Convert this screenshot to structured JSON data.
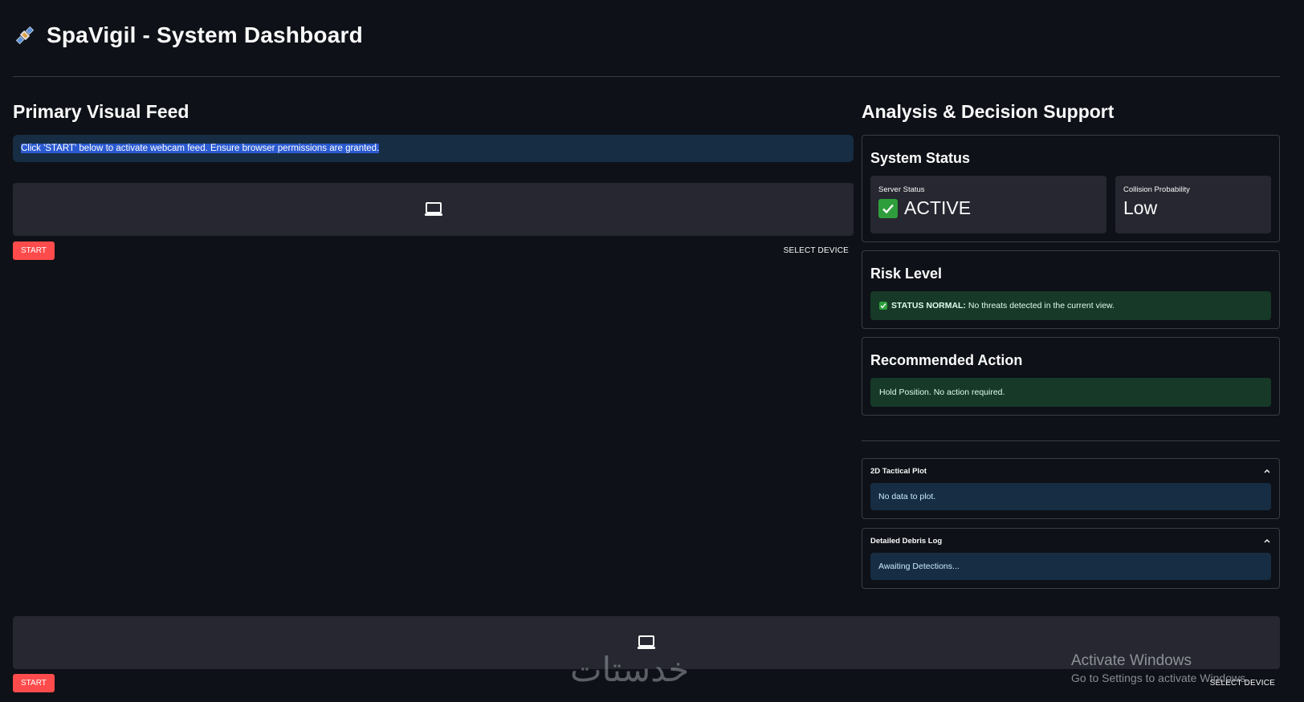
{
  "header": {
    "title": "SpaVigil - System Dashboard",
    "icon": "satellite-icon"
  },
  "left": {
    "heading": "Primary Visual Feed",
    "info": "Click 'START' below to activate webcam feed. Ensure browser permissions are granted.",
    "start_label": "START",
    "select_device_label": "SELECT DEVICE"
  },
  "right": {
    "heading": "Analysis & Decision Support",
    "system_status": {
      "heading": "System Status",
      "server_label": "Server Status",
      "server_value": "ACTIVE",
      "collision_label": "Collision Probability",
      "collision_value": "Low"
    },
    "risk": {
      "heading": "Risk Level",
      "status_bold": "STATUS NORMAL:",
      "status_text": " No threats detected in the current view."
    },
    "recommended": {
      "heading": "Recommended Action",
      "text": "Hold Position. No action required."
    },
    "expanders": [
      {
        "title": "2D Tactical Plot",
        "body": "No data to plot."
      },
      {
        "title": "Detailed Debris Log",
        "body": "Awaiting Detections..."
      }
    ]
  },
  "bottom": {
    "start_label": "START",
    "select_device_label": "SELECT DEVICE"
  },
  "overlay": {
    "watermark": "خدستات",
    "activate_title": "Activate Windows",
    "activate_sub": "Go to Settings to activate Windows."
  },
  "colors": {
    "background": "#0e1117",
    "primary_button": "#ff4b4b",
    "info_bg": "#172d43",
    "success_bg": "#173928",
    "widget_bg": "#262730"
  }
}
